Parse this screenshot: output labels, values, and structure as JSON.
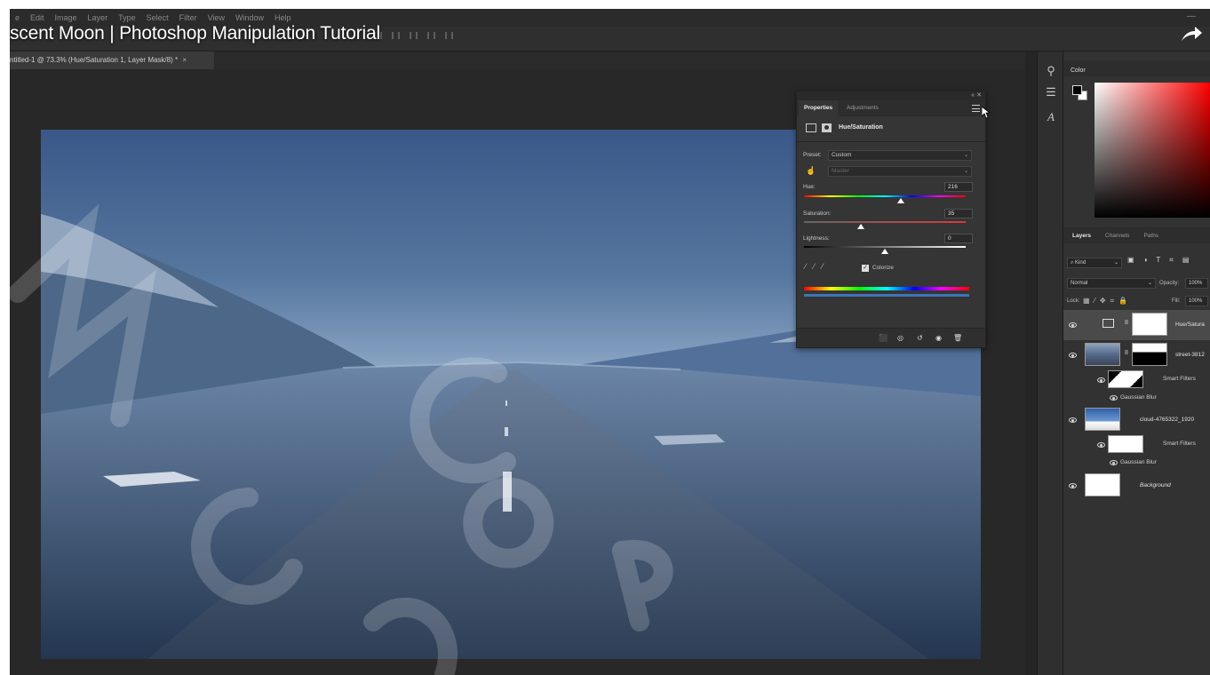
{
  "menu": [
    "e",
    "Edit",
    "Image",
    "Layer",
    "Type",
    "Select",
    "Filter",
    "View",
    "Window",
    "Help"
  ],
  "window_controls": {
    "minimize": "—"
  },
  "video_title": "scent Moon | Photoshop Manipulation Tutorial",
  "document_tab": {
    "label": "ntitled-1 @ 73.3% (Hue/Saturation 1, Layer Mask/8) *",
    "close": "×"
  },
  "properties": {
    "tabs": [
      "Properties",
      "Adjustments"
    ],
    "adjustment_title": "Hue/Saturation",
    "preset_label": "Preset:",
    "preset_value": "Custom",
    "channel_value": "Master",
    "hue_label": "Hue:",
    "hue_value": "216",
    "saturation_label": "Saturation:",
    "saturation_value": "35",
    "lightness_label": "Lightness:",
    "lightness_value": "0",
    "colorize_label": "Colorize",
    "colorize_checked": true,
    "hue_range": [
      -180,
      180
    ],
    "saturation_range": [
      0,
      100
    ],
    "lightness_range": [
      -100,
      100
    ]
  },
  "color_panel": {
    "tab": "Color",
    "foreground": "#000000",
    "background": "#ffffff"
  },
  "layers_panel": {
    "tabs": [
      "Layers",
      "Channels",
      "Paths"
    ],
    "filter_kind": "Kind",
    "blend_mode": "Normal",
    "opacity_label": "Opacity:",
    "opacity_value": "100%",
    "lock_label": "Lock:",
    "fill_label": "Fill:",
    "fill_value": "100%",
    "layers": [
      {
        "name": "Hue/Satura",
        "selected": true
      },
      {
        "name": "street-3812",
        "selected": false
      },
      {
        "name": "cloud-4765322_1920",
        "selected": false
      },
      {
        "name": "Background",
        "selected": false
      }
    ],
    "smart_filters_label": "Smart Filters",
    "gaussian_blur_label": "Gaussian Blur"
  },
  "watermark": {
    "text": "Mockup Copy",
    "color": "#ffffff"
  },
  "colors": {
    "app_bg": "#282828",
    "panel_bg": "#323232",
    "sky": "#4c6d9c",
    "road": "#3a4f6a"
  }
}
